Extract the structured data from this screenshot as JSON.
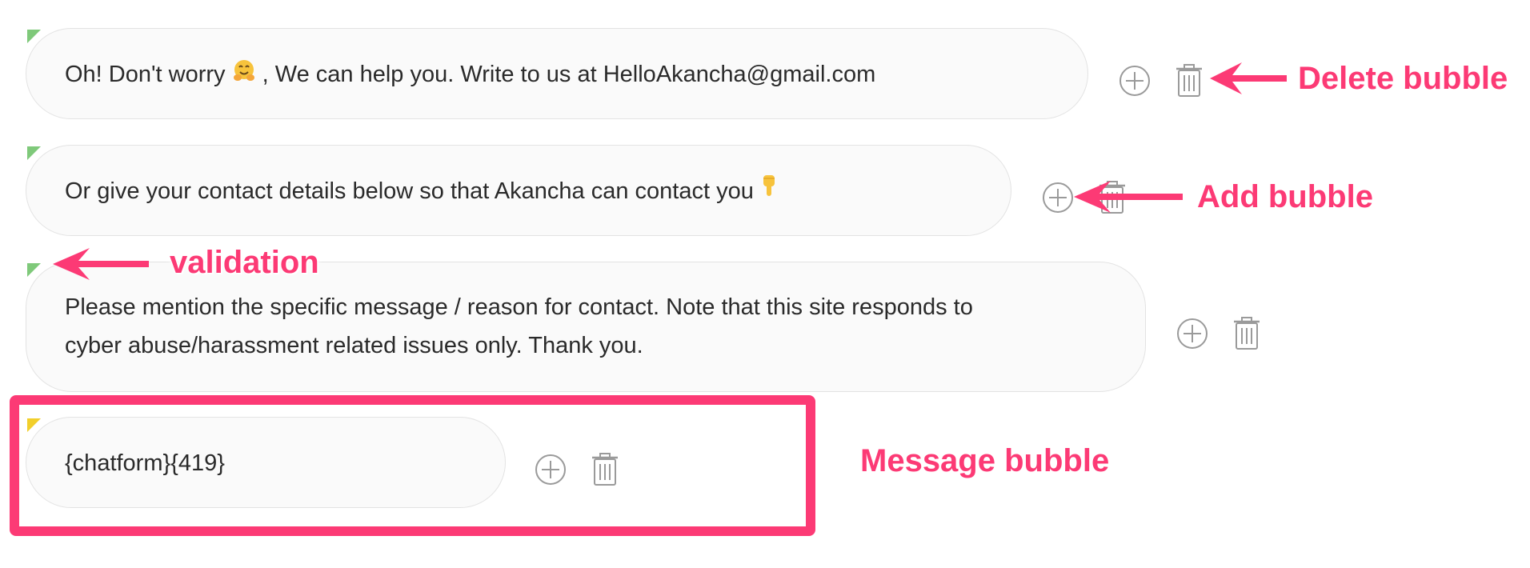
{
  "colors": {
    "accent": "#fc3a75",
    "flag_green": "#7fc97a",
    "flag_yellow": "#f2cf2b",
    "icon": "#9a9a9a",
    "bubble_bg": "#fafafa"
  },
  "bubbles": [
    {
      "text_before": "Oh! Don't worry ",
      "emoji": "hugging-face",
      "text_after": " , We can help you. Write to us at HelloAkancha@gmail.com"
    },
    {
      "text_before": "Or give your contact details below so that Akancha can contact you ",
      "emoji": "pointing-down-hand"
    },
    {
      "line1": "Please mention the specific message / reason for contact. Note that this site responds to",
      "line2": "cyber abuse/harassment related issues only. Thank you."
    },
    {
      "text": "{chatform}{419}"
    }
  ],
  "icons": {
    "add": "plus-circle-icon",
    "delete": "trash-icon"
  },
  "annotations": {
    "delete_bubble": "Delete bubble",
    "add_bubble": "Add bubble",
    "validation": "validation",
    "message_bubble": "Message bubble"
  }
}
